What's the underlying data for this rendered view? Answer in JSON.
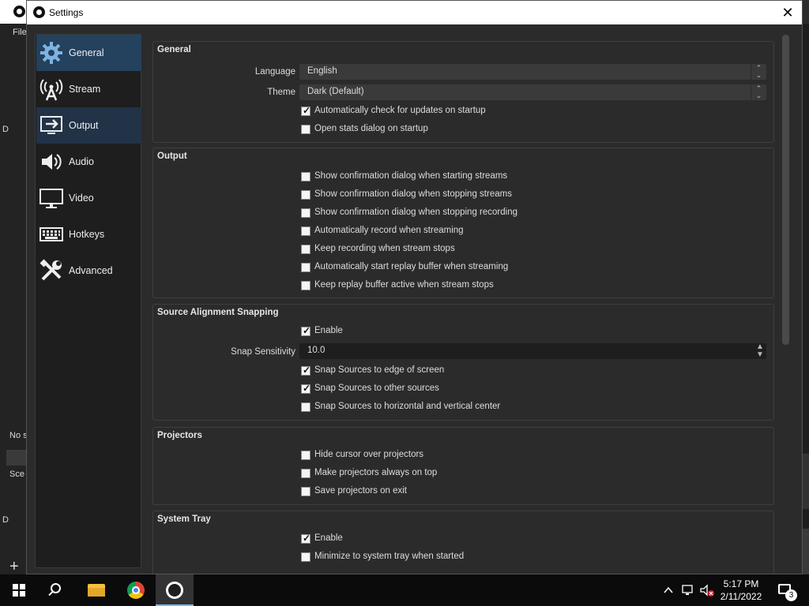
{
  "background": {
    "left_fragments": [
      "File",
      "D",
      "No s",
      "Sce",
      "D"
    ],
    "add_symbol": "+"
  },
  "dialog": {
    "title": "Settings",
    "close_symbol": "✕"
  },
  "sidebar": {
    "items": [
      {
        "label": "General",
        "icon": "gear-icon",
        "state": "selected"
      },
      {
        "label": "Stream",
        "icon": "broadcast-icon",
        "state": "normal"
      },
      {
        "label": "Output",
        "icon": "output-icon",
        "state": "hover"
      },
      {
        "label": "Audio",
        "icon": "speaker-icon",
        "state": "normal"
      },
      {
        "label": "Video",
        "icon": "monitor-icon",
        "state": "normal"
      },
      {
        "label": "Hotkeys",
        "icon": "keyboard-icon",
        "state": "normal"
      },
      {
        "label": "Advanced",
        "icon": "tools-icon",
        "state": "normal"
      }
    ]
  },
  "general": {
    "title": "General",
    "language_label": "Language",
    "language_value": "English",
    "theme_label": "Theme",
    "theme_value": "Dark (Default)",
    "checkboxes": [
      {
        "label": "Automatically check for updates on startup",
        "checked": true
      },
      {
        "label": "Open stats dialog on startup",
        "checked": false
      }
    ]
  },
  "output": {
    "title": "Output",
    "checkboxes": [
      {
        "label": "Show confirmation dialog when starting streams",
        "checked": false
      },
      {
        "label": "Show confirmation dialog when stopping streams",
        "checked": false
      },
      {
        "label": "Show confirmation dialog when stopping recording",
        "checked": false
      },
      {
        "label": "Automatically record when streaming",
        "checked": false
      },
      {
        "label": "Keep recording when stream stops",
        "checked": false
      },
      {
        "label": "Automatically start replay buffer when streaming",
        "checked": false
      },
      {
        "label": "Keep replay buffer active when stream stops",
        "checked": false
      }
    ]
  },
  "snapping": {
    "title": "Source Alignment Snapping",
    "enable": {
      "label": "Enable",
      "checked": true
    },
    "sensitivity_label": "Snap Sensitivity",
    "sensitivity_value": "10.0",
    "checkboxes": [
      {
        "label": "Snap Sources to edge of screen",
        "checked": true
      },
      {
        "label": "Snap Sources to other sources",
        "checked": true
      },
      {
        "label": "Snap Sources to horizontal and vertical center",
        "checked": false
      }
    ]
  },
  "projectors": {
    "title": "Projectors",
    "checkboxes": [
      {
        "label": "Hide cursor over projectors",
        "checked": false
      },
      {
        "label": "Make projectors always on top",
        "checked": false
      },
      {
        "label": "Save projectors on exit",
        "checked": false
      }
    ]
  },
  "system_tray": {
    "title": "System Tray",
    "checkboxes": [
      {
        "label": "Enable",
        "checked": true
      },
      {
        "label": "Minimize to system tray when started",
        "checked": false
      }
    ]
  },
  "taskbar": {
    "apps": [
      "start-icon",
      "search-icon",
      "file-explorer-icon",
      "chrome-icon",
      "obs-icon"
    ],
    "active_app": "obs-icon",
    "time": "5:17 PM",
    "date": "2/11/2022",
    "notification_count": "3",
    "accent": "#76b9ed"
  },
  "colors": {
    "selected_nav": "#24415e",
    "panel_bg": "#2b2b2b",
    "sidebar_bg": "#1e1e1e"
  }
}
